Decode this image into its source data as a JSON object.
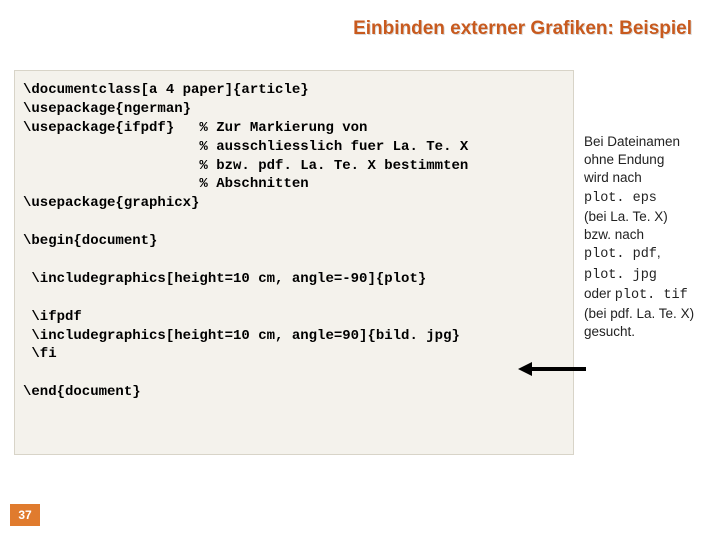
{
  "title": "Einbinden externer Grafiken: Beispiel",
  "code": "\\documentclass[a 4 paper]{article}\n\\usepackage{ngerman}\n\\usepackage{ifpdf}   % Zur Markierung von\n                     % ausschliesslich fuer La. Te. X\n                     % bzw. pdf. La. Te. X bestimmten\n                     % Abschnitten\n\\usepackage{graphicx}\n\n\\begin{document}\n\n \\includegraphics[height=10 cm, angle=-90]{plot}\n\n \\ifpdf\n \\includegraphics[height=10 cm, angle=90]{bild. jpg}\n \\fi\n\n\\end{document}",
  "note": {
    "l1": "Bei Dateinamen",
    "l2": "ohne Endung",
    "l3": "wird nach",
    "c1": "plot. eps",
    "l4": "(bei La. Te. X)",
    "l5": "bzw. nach",
    "c2": "plot. pdf",
    "comma": ",",
    "c3": "plot. jpg",
    "l6": "oder ",
    "c4": "plot. tif",
    "l7": "(bei pdf. La. Te. X)",
    "l8": "gesucht."
  },
  "page_number": "37"
}
